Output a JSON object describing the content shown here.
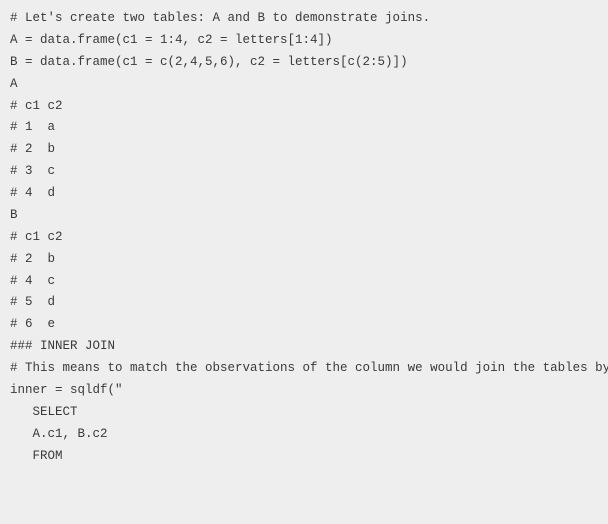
{
  "lines": [
    "# Let's create two tables: A and B to demonstrate joins.",
    "A = data.frame(c1 = 1:4, c2 = letters[1:4])",
    "B = data.frame(c1 = c(2,4,5,6), c2 = letters[c(2:5)])",
    "",
    "A",
    "# c1 c2",
    "# 1  a",
    "# 2  b",
    "# 3  c",
    "# 4  d",
    "",
    "B",
    "# c1 c2",
    "# 2  b",
    "# 4  c",
    "# 5  d",
    "# 6  e",
    "",
    "### INNER JOIN",
    "# This means to match the observations of the column we would join the tables by.",
    "inner = sqldf(\"",
    "   SELECT",
    "   A.c1, B.c2",
    "   FROM"
  ]
}
